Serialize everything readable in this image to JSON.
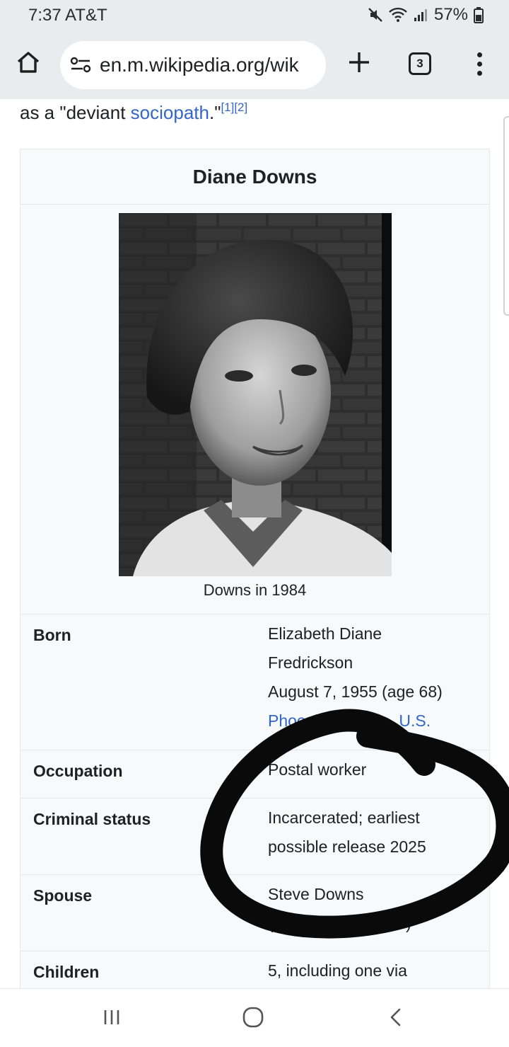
{
  "status_bar": {
    "time_carrier": "7:37 AT&T",
    "battery": "57%",
    "icons": [
      "mute-icon",
      "wifi-icon",
      "signal-icon",
      "battery-icon"
    ]
  },
  "browser": {
    "url": "en.m.wikipedia.org/wik",
    "tab_count": "3",
    "icons": [
      "home-icon",
      "site-settings-icon",
      "new-tab-icon",
      "tab-switcher-icon",
      "overflow-menu-icon"
    ]
  },
  "article": {
    "lead_prefix": "as a \"deviant ",
    "lead_link": "sociopath",
    "lead_suffix": ".\"",
    "lead_refs": "[1][2]"
  },
  "infobox": {
    "title": "Diane Downs",
    "image_caption": "Downs in 1984",
    "rows": [
      {
        "label": "Born",
        "lines": [
          "Elizabeth Diane",
          "Fredrickson",
          "August 7, 1955 (age 68)",
          "Phoenix, Arizona, U.S."
        ]
      },
      {
        "label": "Occupation",
        "lines": [
          "Postal worker"
        ]
      },
      {
        "label": "Criminal status",
        "lines": [
          "Incarcerated; earliest",
          "possible release 2025"
        ]
      },
      {
        "label": "Spouse",
        "lines": [
          "Steve Downs",
          "(m. 1973; div. 1980)"
        ]
      },
      {
        "label": "Children",
        "lines": [
          "5, including one via"
        ]
      }
    ]
  },
  "annotation": {
    "ink_color": "#0a0a0a"
  },
  "nav_bar": {
    "icons": [
      "recents-icon",
      "home-circle-icon",
      "back-icon"
    ]
  }
}
